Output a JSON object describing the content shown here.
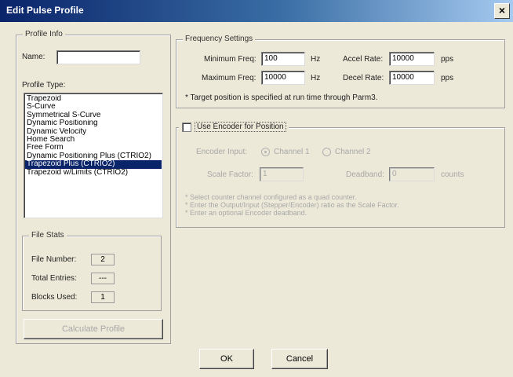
{
  "window": {
    "title": "Edit Pulse Profile",
    "close_glyph": "×"
  },
  "profile_info": {
    "legend": "Profile Info",
    "name_label": "Name:",
    "name_value": ""
  },
  "profile_type": {
    "label": "Profile Type:",
    "items": [
      "Trapezoid",
      "S-Curve",
      "Symmetrical S-Curve",
      "Dynamic Positioning",
      "Dynamic Velocity",
      "Home Search",
      "Free Form",
      "Dynamic Positioning Plus (CTRIO2)",
      "Trapezoid Plus (CTRIO2)",
      "Trapezoid w/Limits (CTRIO2)"
    ],
    "selected_index": 8
  },
  "file_stats": {
    "legend": "File Stats",
    "file_number_label": "File Number:",
    "file_number_value": "2",
    "total_entries_label": "Total Entries:",
    "total_entries_value": "---",
    "blocks_used_label": "Blocks Used:",
    "blocks_used_value": "1"
  },
  "calculate_button": "Calculate Profile",
  "frequency": {
    "legend": "Frequency Settings",
    "min_freq_label": "Minimum Freq:",
    "min_freq_value": "100",
    "min_freq_unit": "Hz",
    "max_freq_label": "Maximum Freq:",
    "max_freq_value": "10000",
    "max_freq_unit": "Hz",
    "accel_label": "Accel Rate:",
    "accel_value": "10000",
    "accel_unit": "pps",
    "decel_label": "Decel Rate:",
    "decel_value": "10000",
    "decel_unit": "pps",
    "note": "* Target position is specified at run time through Parm3."
  },
  "encoder": {
    "checkbox_label": "Use Encoder for Position",
    "checked": false,
    "input_label": "Encoder Input:",
    "channel1_label": "Channel 1",
    "channel2_label": "Channel 2",
    "scale_label": "Scale Factor:",
    "scale_value": "1",
    "deadband_label": "Deadband:",
    "deadband_value": "0",
    "deadband_unit": "counts",
    "notes": [
      "* Select counter channel configured as a quad counter.",
      "* Enter the Output/Input (Stepper/Encoder) ratio as the Scale Factor.",
      "* Enter an optional Encoder deadband."
    ]
  },
  "ok_button": "OK",
  "cancel_button": "Cancel"
}
